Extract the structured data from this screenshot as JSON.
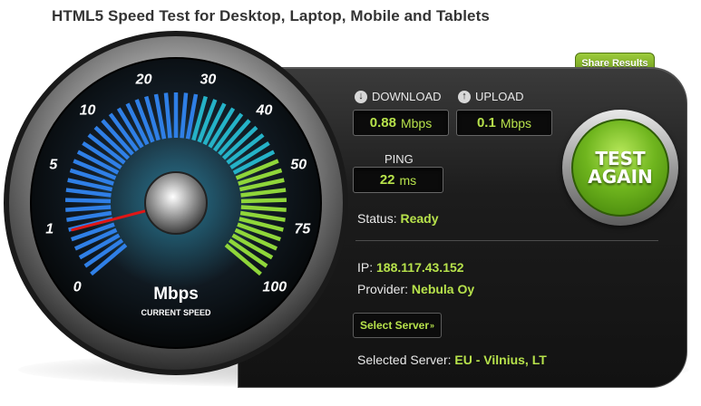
{
  "page_title": "HTML5 Speed Test for Desktop, Laptop, Mobile and Tablets",
  "share_label": "Share Results",
  "download": {
    "label": "DOWNLOAD",
    "value": "0.88",
    "unit": "Mbps",
    "icon": "arrow-down-icon"
  },
  "upload": {
    "label": "UPLOAD",
    "value": "0.1",
    "unit": "Mbps",
    "icon": "arrow-up-icon"
  },
  "ping": {
    "label": "PING",
    "value": "22",
    "unit": "ms"
  },
  "test_button": {
    "line1": "TEST",
    "line2": "AGAIN"
  },
  "status": {
    "label": "Status:",
    "value": "Ready"
  },
  "ip": {
    "label": "IP:",
    "value": "188.117.43.152"
  },
  "provider": {
    "label": "Provider:",
    "value": "Nebula Oy"
  },
  "select_server_label": "Select Server",
  "selected_server": {
    "label": "Selected Server:",
    "value": "EU - Vilnius, LT"
  },
  "gauge": {
    "unit_label": "Mbps",
    "caption": "CURRENT SPEED",
    "ticks": [
      "0",
      "1",
      "5",
      "10",
      "20",
      "30",
      "40",
      "50",
      "75",
      "100"
    ],
    "current_value_mbps": 0.88,
    "colors": {
      "blue": "#2f7fe6",
      "teal": "#25b2c7",
      "green": "#8fd63a",
      "needle": "#e01616"
    }
  }
}
